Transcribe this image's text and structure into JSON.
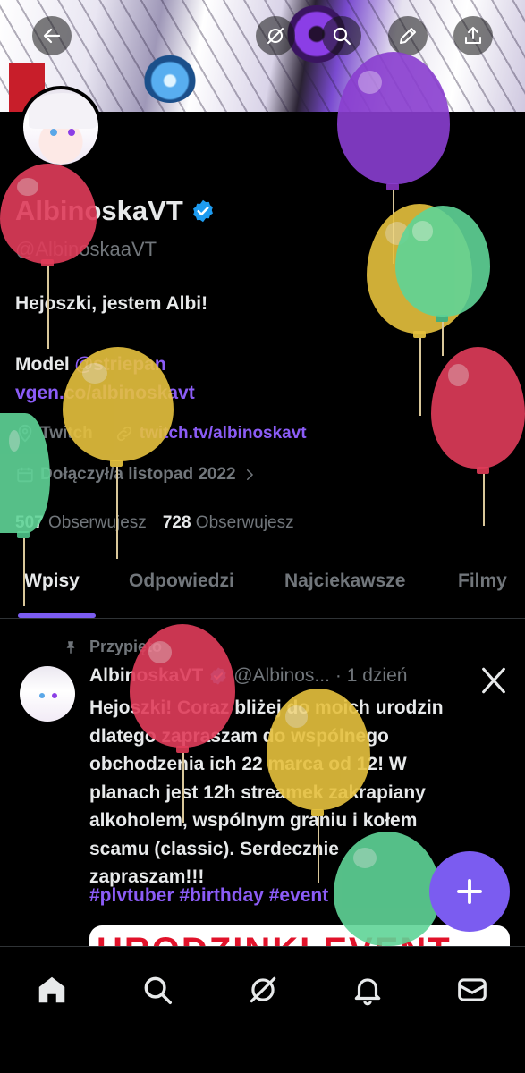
{
  "profile": {
    "display_name": "AlbinoskaVT",
    "handle": "@AlbinoskaaVT",
    "bio_line1": "Hejoszki, jestem Albi!",
    "bio_line2_prefix": "Model ",
    "bio_line2_link": "@striepan",
    "bio_line3_link": "vgen.co/albinoskavt",
    "location": "Twitch",
    "website": "twitch.tv/albinoskavt",
    "joined": "Dołączył/a listopad 2022",
    "following_count": "507",
    "following_label": "Obserwujesz",
    "followers_count": "728",
    "followers_label": "Obserwujesz"
  },
  "tabs": [
    {
      "label": "Wpisy"
    },
    {
      "label": "Odpowiedzi"
    },
    {
      "label": "Najciekawsze"
    },
    {
      "label": "Filmy"
    }
  ],
  "post": {
    "pinned_label": "Przypięto",
    "author_name": "AlbinoskaVT",
    "author_handle": "@Albinos...",
    "time": "· 1 dzień",
    "text": "Hejoszki! Coraz bliżej do moich urodzin\ndlatego zapraszam do wspólnego\nobchodzenia  ich 22 marca od 12! W\nplanach jest 12h streamek zakrapiany\nalkoholem, wspólnym graniu i kołem\nscamu (classic). Serdecznie\nzapraszam!!!",
    "hashtags": "#plvtuber #birthday #event",
    "image_text": "URODZINKI EVENT"
  },
  "icons": {
    "back": "arrow-left-icon",
    "grok": "grok-icon",
    "search": "search-icon",
    "edit": "pencil-icon",
    "share": "share-icon",
    "verified": "verified-badge-icon",
    "location": "location-pin-icon",
    "link": "link-icon",
    "calendar": "calendar-icon",
    "pin": "pin-icon",
    "x": "x-logo-icon",
    "compose": "plus-icon",
    "home": "home-icon",
    "notifications": "bell-icon",
    "messages": "mail-icon"
  },
  "colors": {
    "accent": "#7b5cf0",
    "link": "#8b5cf6",
    "verified": "#1d9bf0",
    "muted": "#71767b",
    "text": "#e7e9ea",
    "background": "#000000"
  }
}
